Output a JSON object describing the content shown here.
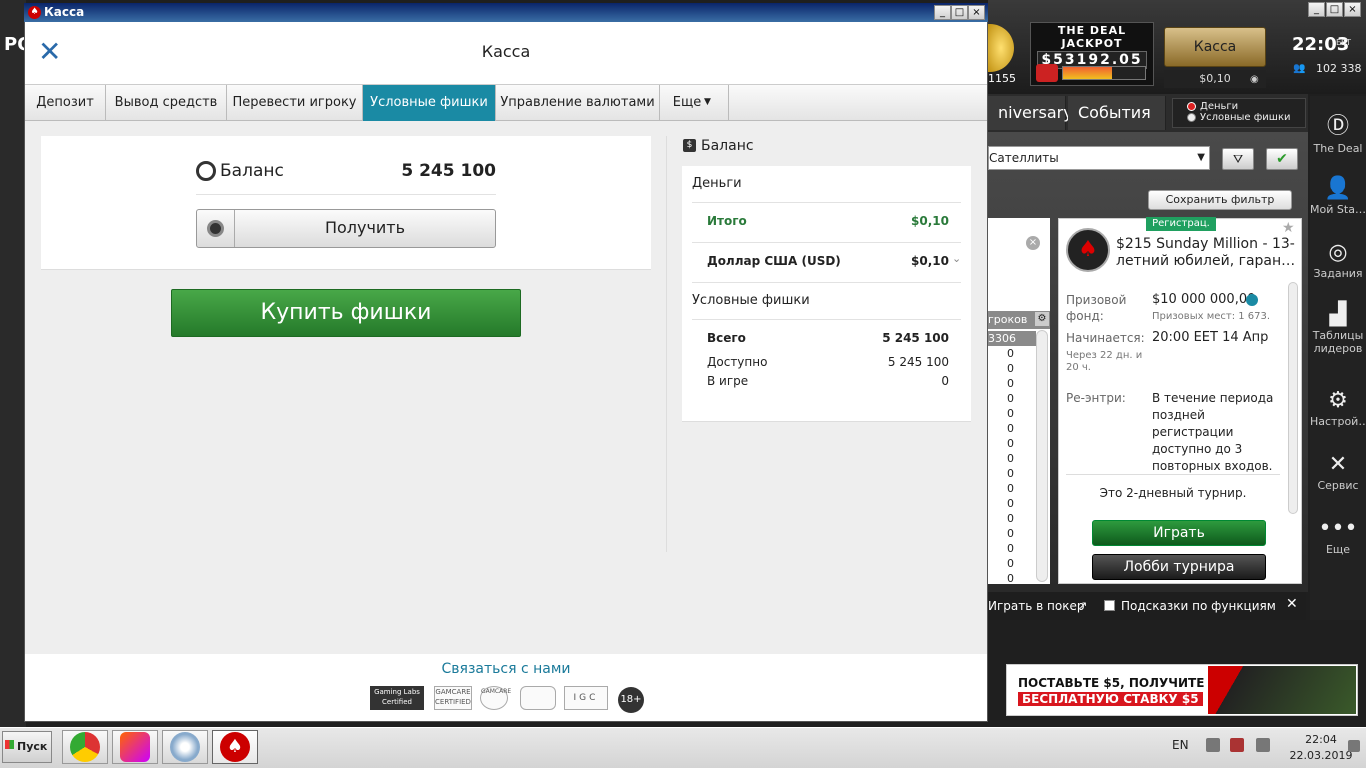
{
  "lobby": {
    "left_logo": "PO",
    "jackpot_title": "THE DEAL JACKPOT",
    "jackpot_value": "$53192.05",
    "jackpot_fill": 0.6,
    "kassa_button": "Касса",
    "kassa_balance": "$0,10",
    "clock": "22:03",
    "clock_tz": "EET",
    "players_online": "102 338",
    "coin_count": "1155",
    "tab_anniversary": "niversary",
    "tab_events": "События",
    "radio_money": "Деньги",
    "radio_chips": "Условные фишки",
    "filter_value": "Сателлиты",
    "save_filter": "Сохранить фильтр",
    "list_header": "гроков",
    "list_first": "3306",
    "list_values": [
      "0",
      "0",
      "0",
      "0",
      "0",
      "0",
      "0",
      "0",
      "0",
      "0",
      "0",
      "0",
      "0",
      "0",
      "0",
      "0"
    ],
    "tourney": {
      "badge": "Регистрац.",
      "name": "$215 Sunday Million - 13-летний юбилей, гаран…",
      "prize_label": "Призовой фонд:",
      "prize_value": "$10 000 000,00",
      "prize_places": "Призовых мест: 1 673.",
      "start_label": "Начинается:",
      "start_value": "20:00 EET 14 Апр",
      "start_in": "Через 22 дн. и 20 ч.",
      "reentry_label": "Ре-энтри:",
      "reentry_value": "В течение периода поздней регистрации доступно до 3 повторных входов.",
      "two_day": "Это 2-дневный турнир.",
      "play": "Играть",
      "lobby": "Лобби турнира"
    },
    "bottom_play": "Играть в покер",
    "bottom_hints": "Подсказки по функциям",
    "nav": [
      {
        "icon": "the-deal-icon",
        "label": "The Deal"
      },
      {
        "icon": "user-icon",
        "label": "Мой Sta…"
      },
      {
        "icon": "target-icon",
        "label": "Задания"
      },
      {
        "icon": "leaderboard-icon",
        "label": "Таблицы лидеров"
      },
      {
        "icon": "gear-icon",
        "label": "Настрой…"
      },
      {
        "icon": "tools-icon",
        "label": "Сервис"
      },
      {
        "icon": "more-icon",
        "label": "Еще"
      }
    ],
    "banner_line1": "ПОСТАВЬТЕ $5, ПОЛУЧИТЕ",
    "banner_line2": "БЕСПЛАТНУЮ СТАВКУ $5"
  },
  "cashier": {
    "window_title": "Касса",
    "heading": "Касса",
    "tabs": [
      "Депозит",
      "Вывод средств",
      "Перевести игроку",
      "Условные фишки",
      "Управление валютами",
      "Еще"
    ],
    "active_tab": "Условные фишки",
    "balance_label": "Баланс",
    "balance_value": "5 245 100",
    "get_button": "Получить",
    "buy_button": "Купить фишки",
    "sidebar": {
      "title": "Баланс",
      "money_header": "Деньги",
      "total_label": "Итого",
      "total_value": "$0,10",
      "usd_label": "Доллар США (USD)",
      "usd_value": "$0,10",
      "chips_header": "Условные фишки",
      "all_label": "Всего",
      "all_value": "5 245 100",
      "available_label": "Доступно",
      "available_value": "5 245 100",
      "ingame_label": "В игре",
      "ingame_value": "0"
    },
    "contact": "Связаться с нами",
    "badges": [
      "Gaming Labs Certified",
      "GAMCARE CERTIFIED",
      "GAMCARE",
      "",
      "IGC",
      "18+"
    ]
  },
  "taskbar": {
    "start": "Пуск",
    "lang": "EN",
    "time": "22:04",
    "date": "22.03.2019"
  },
  "colors": {
    "accent_tab": "#1a8aa4",
    "buy_green": "#3a9a3e",
    "total_green": "#2a7a3a"
  }
}
